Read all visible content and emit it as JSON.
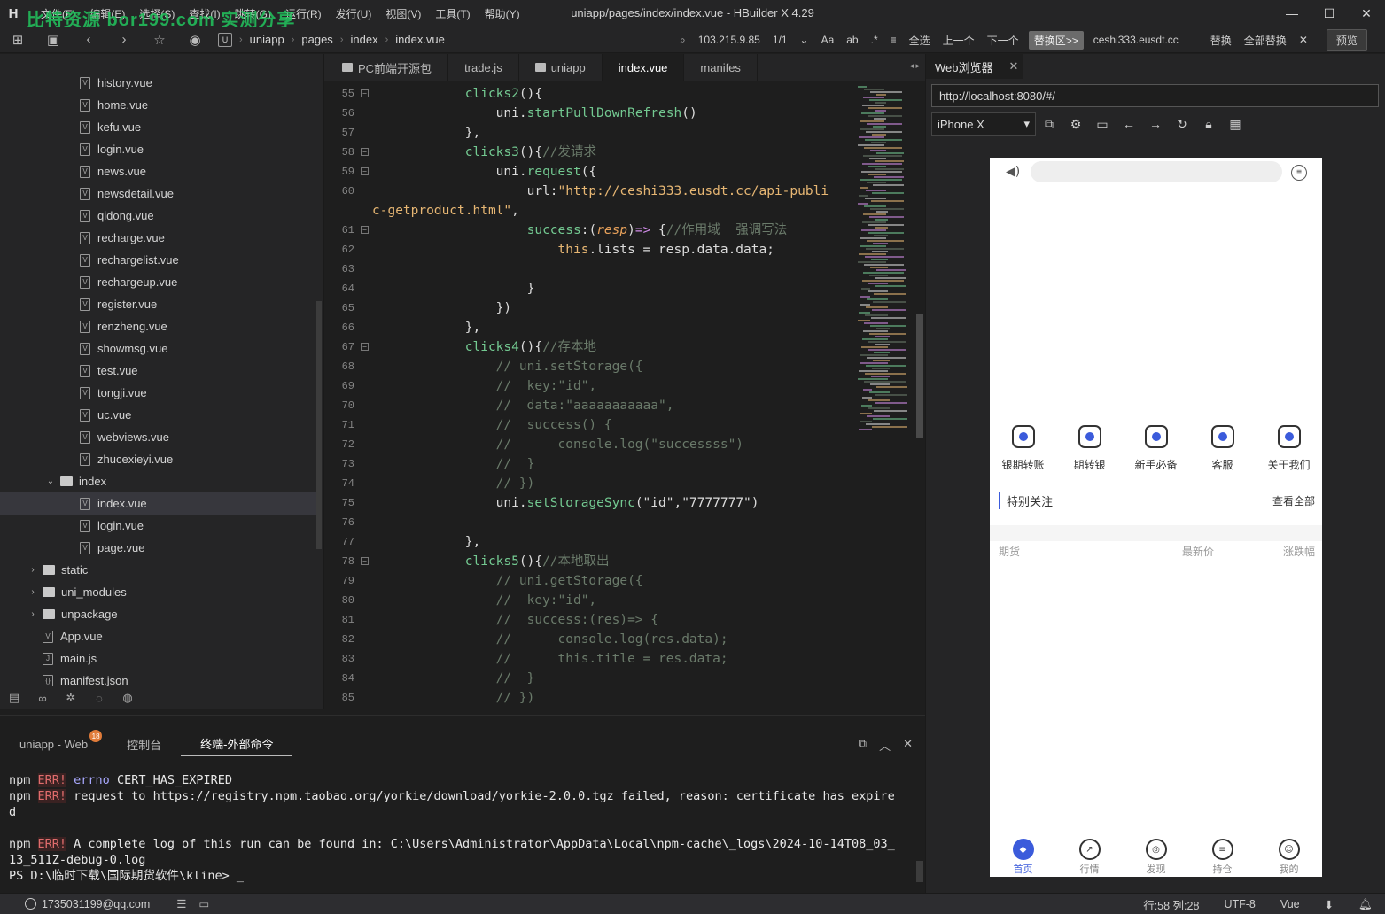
{
  "window": {
    "title": "uniapp/pages/index/index.vue - HBuilder X 4.29",
    "logo": "H",
    "watermark": "比特资源 bor199.com 实测分享",
    "menu": [
      "文件(F)",
      "编辑(E)",
      "选择(S)",
      "查找(I)",
      "跳转(G)",
      "运行(R)",
      "发行(U)",
      "视图(V)",
      "工具(T)",
      "帮助(Y)"
    ],
    "controls": {
      "minimize": "—",
      "maximize": "☐",
      "close": "✕"
    }
  },
  "toolbar": {
    "icons": [
      "sidebar-toggle-icon",
      "save-icon",
      "back-icon",
      "forward-icon",
      "star-icon",
      "run-icon"
    ],
    "breadcrumb": [
      "uniapp",
      "pages",
      "index",
      "index.vue"
    ],
    "find": {
      "search_value": "103.215.9.85",
      "match_count": "1/1",
      "replace_toggle": "替换区>>",
      "replace_value": "ceshi333.eusdt.cc",
      "select_all": "全选",
      "prev": "上一个",
      "next": "下一个",
      "replace": "替换",
      "replace_all": "全部替换",
      "preview": "预览"
    }
  },
  "sidebar": {
    "files": [
      {
        "label": "history.vue",
        "type": "file",
        "depth": 2
      },
      {
        "label": "home.vue",
        "type": "file",
        "depth": 2
      },
      {
        "label": "kefu.vue",
        "type": "file",
        "depth": 2
      },
      {
        "label": "login.vue",
        "type": "file",
        "depth": 2
      },
      {
        "label": "news.vue",
        "type": "file",
        "depth": 2
      },
      {
        "label": "newsdetail.vue",
        "type": "file",
        "depth": 2
      },
      {
        "label": "qidong.vue",
        "type": "file",
        "depth": 2
      },
      {
        "label": "recharge.vue",
        "type": "file",
        "depth": 2
      },
      {
        "label": "rechargelist.vue",
        "type": "file",
        "depth": 2
      },
      {
        "label": "rechargeup.vue",
        "type": "file",
        "depth": 2
      },
      {
        "label": "register.vue",
        "type": "file",
        "depth": 2
      },
      {
        "label": "renzheng.vue",
        "type": "file",
        "depth": 2
      },
      {
        "label": "showmsg.vue",
        "type": "file",
        "depth": 2
      },
      {
        "label": "test.vue",
        "type": "file",
        "depth": 2
      },
      {
        "label": "tongji.vue",
        "type": "file",
        "depth": 2
      },
      {
        "label": "uc.vue",
        "type": "file",
        "depth": 2
      },
      {
        "label": "webviews.vue",
        "type": "file",
        "depth": 2
      },
      {
        "label": "zhucexieyi.vue",
        "type": "file",
        "depth": 2
      },
      {
        "label": "index",
        "type": "folder-open",
        "depth": 1
      },
      {
        "label": "index.vue",
        "type": "file",
        "depth": 2,
        "selected": true
      },
      {
        "label": "login.vue",
        "type": "file",
        "depth": 2
      },
      {
        "label": "page.vue",
        "type": "file",
        "depth": 2
      },
      {
        "label": "static",
        "type": "folder",
        "depth": 0
      },
      {
        "label": "uni_modules",
        "type": "folder",
        "depth": 0
      },
      {
        "label": "unpackage",
        "type": "folder",
        "depth": 0
      },
      {
        "label": "App.vue",
        "type": "file",
        "depth": 1
      },
      {
        "label": "main.js",
        "type": "file",
        "depth": 1
      },
      {
        "label": "manifest.json",
        "type": "file",
        "depth": 1
      }
    ],
    "bottom_icons": [
      "project-icon",
      "binoculars-icon",
      "bug-icon",
      "plugin-icon",
      "globe-icon"
    ]
  },
  "editor": {
    "tabs": [
      {
        "label": "PC前端开源包",
        "folder": true
      },
      {
        "label": "trade.js"
      },
      {
        "label": "uniapp",
        "folder": true
      },
      {
        "label": "index.vue",
        "active": true
      },
      {
        "label": "manifes"
      }
    ],
    "lines": [
      {
        "n": "55",
        "fold": true,
        "parts": [
          [
            "id",
            "            "
          ],
          [
            "fn",
            "clicks2"
          ],
          [
            "id",
            "(){"
          ]
        ]
      },
      {
        "n": "56",
        "parts": [
          [
            "id",
            "                uni."
          ],
          [
            "fn",
            "startPullDownRefresh"
          ],
          [
            "id",
            "()"
          ]
        ]
      },
      {
        "n": "57",
        "parts": [
          [
            "id",
            "            },"
          ]
        ]
      },
      {
        "n": "58",
        "fold": true,
        "parts": [
          [
            "id",
            "            "
          ],
          [
            "fn",
            "clicks3"
          ],
          [
            "id",
            "(){"
          ],
          [
            "cm",
            "//发请求"
          ]
        ]
      },
      {
        "n": "59",
        "fold": true,
        "parts": [
          [
            "id",
            "                uni."
          ],
          [
            "fn",
            "request"
          ],
          [
            "id",
            "({"
          ]
        ]
      },
      {
        "n": "60",
        "parts": [
          [
            "id",
            "                    url:"
          ],
          [
            "str",
            "\"http://ceshi333.eusdt.cc/api-publi"
          ]
        ]
      },
      {
        "n": "",
        "parts": [
          [
            "str",
            "c-getproduct.html\""
          ],
          [
            "id",
            ","
          ]
        ]
      },
      {
        "n": "61",
        "fold": true,
        "parts": [
          [
            "id",
            "                    "
          ],
          [
            "fn",
            "success"
          ],
          [
            "id",
            ":("
          ],
          [
            "pr",
            "resp"
          ],
          [
            "id",
            ")"
          ],
          [
            "kw",
            "=>"
          ],
          [
            "id",
            " {"
          ],
          [
            "cm",
            "//作用域  强调写法"
          ]
        ]
      },
      {
        "n": "62",
        "parts": [
          [
            "id",
            "                        "
          ],
          [
            "str",
            "this"
          ],
          [
            "id",
            ".lists = resp.data.data;"
          ]
        ]
      },
      {
        "n": "63",
        "parts": [
          [
            "id",
            ""
          ]
        ]
      },
      {
        "n": "64",
        "parts": [
          [
            "id",
            "                    }"
          ]
        ]
      },
      {
        "n": "65",
        "parts": [
          [
            "id",
            "                })"
          ]
        ]
      },
      {
        "n": "66",
        "parts": [
          [
            "id",
            "            },"
          ]
        ]
      },
      {
        "n": "67",
        "fold": true,
        "parts": [
          [
            "id",
            "            "
          ],
          [
            "fn",
            "clicks4"
          ],
          [
            "id",
            "(){"
          ],
          [
            "cm",
            "//存本地"
          ]
        ]
      },
      {
        "n": "68",
        "parts": [
          [
            "cm",
            "                // uni.setStorage({"
          ]
        ]
      },
      {
        "n": "69",
        "parts": [
          [
            "cm",
            "                //  key:\"id\","
          ]
        ]
      },
      {
        "n": "70",
        "parts": [
          [
            "cm",
            "                //  data:\"aaaaaaaaaaa\","
          ]
        ]
      },
      {
        "n": "71",
        "parts": [
          [
            "cm",
            "                //  success() {"
          ]
        ]
      },
      {
        "n": "72",
        "parts": [
          [
            "cm",
            "                //      console.log(\"successss\")"
          ]
        ]
      },
      {
        "n": "73",
        "parts": [
          [
            "cm",
            "                //  }"
          ]
        ]
      },
      {
        "n": "74",
        "parts": [
          [
            "cm",
            "                // })"
          ]
        ]
      },
      {
        "n": "75",
        "parts": [
          [
            "id",
            "                uni."
          ],
          [
            "fn",
            "setStorageSync"
          ],
          [
            "id",
            "(\"id\",\"7777777\")"
          ]
        ]
      },
      {
        "n": "76",
        "parts": [
          [
            "id",
            ""
          ]
        ]
      },
      {
        "n": "77",
        "parts": [
          [
            "id",
            "            },"
          ]
        ]
      },
      {
        "n": "78",
        "fold": true,
        "parts": [
          [
            "id",
            "            "
          ],
          [
            "fn",
            "clicks5"
          ],
          [
            "id",
            "(){"
          ],
          [
            "cm",
            "//本地取出"
          ]
        ]
      },
      {
        "n": "79",
        "parts": [
          [
            "cm",
            "                // uni.getStorage({"
          ]
        ]
      },
      {
        "n": "80",
        "parts": [
          [
            "cm",
            "                //  key:\"id\","
          ]
        ]
      },
      {
        "n": "81",
        "parts": [
          [
            "cm",
            "                //  success:(res)=> {"
          ]
        ]
      },
      {
        "n": "82",
        "parts": [
          [
            "cm",
            "                //      console.log(res.data);"
          ]
        ]
      },
      {
        "n": "83",
        "parts": [
          [
            "cm",
            "                //      this.title = res.data;"
          ]
        ]
      },
      {
        "n": "84",
        "parts": [
          [
            "cm",
            "                //  }"
          ]
        ]
      },
      {
        "n": "85",
        "parts": [
          [
            "cm",
            "                // })"
          ]
        ]
      }
    ]
  },
  "panel": {
    "tabs": [
      {
        "label": "uniapp - Web",
        "badge": "18"
      },
      {
        "label": "控制台"
      },
      {
        "label": "终端-外部命令",
        "active": true
      }
    ],
    "icons": [
      "export-icon",
      "chevron-up-icon",
      "close-panel-icon"
    ],
    "terminal": [
      [
        [
          "npm",
          "npm "
        ],
        [
          "err",
          "ERR!"
        ],
        [
          "dim",
          " errno"
        ],
        [
          "txt",
          " CERT_HAS_EXPIRED"
        ]
      ],
      [
        [
          "npm",
          "npm "
        ],
        [
          "err",
          "ERR!"
        ],
        [
          "txt",
          " request to https://registry.npm.taobao.org/yorkie/download/yorkie-2.0.0.tgz failed, reason: certificate has expire"
        ]
      ],
      [
        [
          "txt",
          "d"
        ]
      ],
      [
        [
          "txt",
          ""
        ]
      ],
      [
        [
          "npm",
          "npm "
        ],
        [
          "err",
          "ERR!"
        ],
        [
          "txt",
          " A complete log of this run can be found in: C:\\Users\\Administrator\\AppData\\Local\\npm-cache\\_logs\\2024-10-14T08_03_"
        ]
      ],
      [
        [
          "txt",
          "13_511Z-debug-0.log"
        ]
      ],
      [
        [
          "txt",
          "PS D:\\临时下载\\国际期货软件\\kline> _"
        ]
      ]
    ]
  },
  "browser": {
    "tab_label": "Web浏览器",
    "url": "http://localhost:8080/#/",
    "device": "iPhone X",
    "dev_icons": [
      "screenshot-icon",
      "settings-icon",
      "console-icon",
      "back-icon",
      "forward-icon",
      "reload-icon",
      "lock-icon",
      "qr-icon"
    ],
    "phone": {
      "quick_items": [
        {
          "label": "银期转账",
          "icon": "transfer-icon"
        },
        {
          "label": "期转银",
          "icon": "bank-icon"
        },
        {
          "label": "新手必备",
          "icon": "book-icon"
        },
        {
          "label": "客服",
          "icon": "headset-icon"
        },
        {
          "label": "关于我们",
          "icon": "about-icon"
        }
      ],
      "section_title": "特别关注",
      "section_more": "查看全部",
      "columns": [
        "期货",
        "最新价",
        "涨跌幅"
      ],
      "tabbar": [
        {
          "label": "首页",
          "active": true,
          "icon": "home-icon"
        },
        {
          "label": "行情",
          "icon": "market-icon"
        },
        {
          "label": "发现",
          "icon": "compass-icon"
        },
        {
          "label": "持仓",
          "icon": "position-icon"
        },
        {
          "label": "我的",
          "icon": "profile-icon"
        }
      ]
    }
  },
  "status": {
    "user": "1735031199@qq.com",
    "position": "行:58  列:28",
    "encoding": "UTF-8",
    "language": "Vue"
  },
  "colors": {
    "accent": "#3b5bdb",
    "watermark": "#22c55e",
    "function": "#73c991",
    "string": "#e6b673",
    "comment": "#6a7a6a"
  }
}
